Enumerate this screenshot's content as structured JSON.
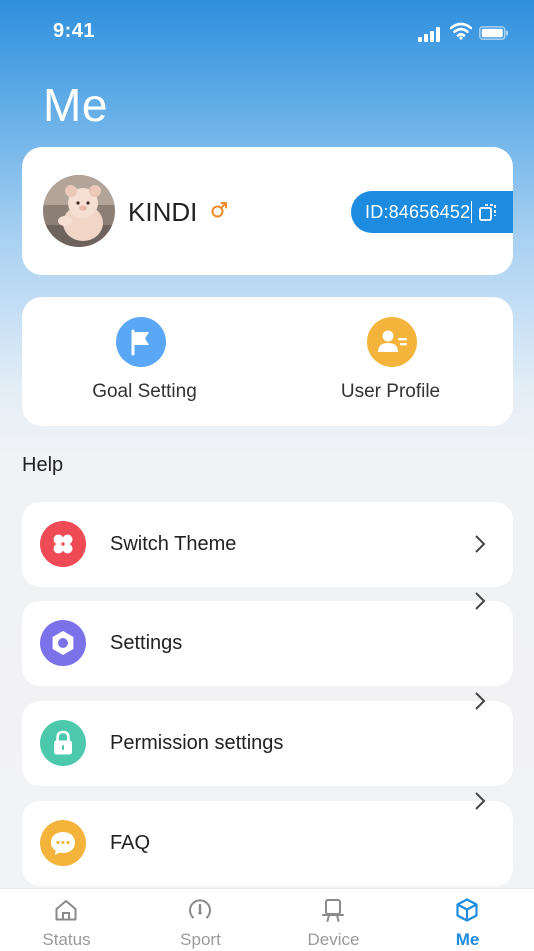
{
  "status_bar": {
    "time": "9:41"
  },
  "page": {
    "title": "Me"
  },
  "profile": {
    "name": "KINDI",
    "id_label": "ID:84656452"
  },
  "quick_actions": [
    {
      "label": "Goal Setting",
      "icon": "flag-icon",
      "color": "#5aa7f5"
    },
    {
      "label": "User Profile",
      "icon": "user-card-icon",
      "color": "#f4b43c"
    }
  ],
  "help": {
    "title": "Help",
    "items": [
      {
        "label": "Switch Theme",
        "icon": "theme-icon",
        "color": "#ef4b57"
      },
      {
        "label": "Settings",
        "icon": "gear-icon",
        "color": "#7b72ea"
      },
      {
        "label": "Permission settings",
        "icon": "lock-icon",
        "color": "#4cc8ac"
      },
      {
        "label": "FAQ",
        "icon": "chat-bubble-icon",
        "color": "#f4b43c"
      }
    ]
  },
  "tabs": [
    {
      "label": "Status",
      "icon": "home-icon"
    },
    {
      "label": "Sport",
      "icon": "gauge-icon"
    },
    {
      "label": "Device",
      "icon": "watch-icon"
    },
    {
      "label": "Me",
      "icon": "cube-icon",
      "active": true
    }
  ],
  "colors": {
    "accent": "#1d8be0",
    "gender_icon": "#f08a24"
  }
}
